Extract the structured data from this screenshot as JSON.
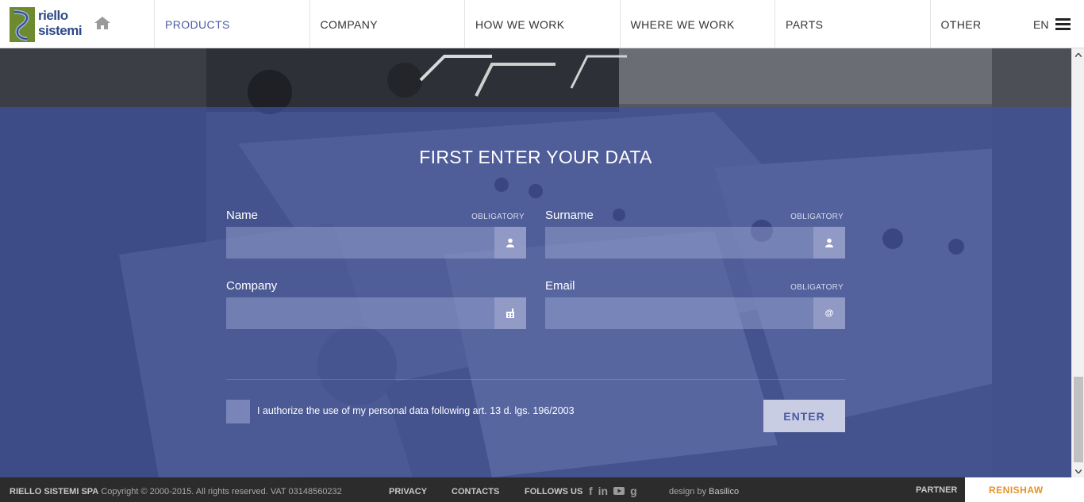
{
  "header": {
    "logo_text_line1": "riello",
    "logo_text_line2": "sistemi",
    "nav": [
      {
        "label": "PRODUCTS",
        "active": true
      },
      {
        "label": "COMPANY"
      },
      {
        "label": "HOW WE WORK"
      },
      {
        "label": "WHERE WE WORK"
      },
      {
        "label": "PARTS"
      },
      {
        "label": "OTHER"
      }
    ],
    "language": "EN"
  },
  "form": {
    "title": "FIRST ENTER YOUR DATA",
    "fields": {
      "name": {
        "label": "Name",
        "required": "OBLIGATORY",
        "value": "",
        "icon": "user-icon"
      },
      "surname": {
        "label": "Surname",
        "required": "OBLIGATORY",
        "value": "",
        "icon": "user-icon"
      },
      "company": {
        "label": "Company",
        "value": "",
        "icon": "building-icon"
      },
      "email": {
        "label": "Email",
        "required": "OBLIGATORY",
        "value": "",
        "icon": "at-icon",
        "icon_glyph": "@"
      }
    },
    "consent_text": "I authorize the use of my personal data following art. 13 d. lgs. 196/2003",
    "submit_label": "ENTER"
  },
  "footer": {
    "company": "RIELLO SISTEMI SPA",
    "copyright": "Copyright © 2000-2015. All rights reserved. VAT 03148560232",
    "privacy": "PRIVACY",
    "contacts": "CONTACTS",
    "follow_us": "FOLLOWS US",
    "social": [
      "facebook-icon",
      "linkedin-icon",
      "youtube-icon",
      "google-plus-icon"
    ],
    "design_by_label": "design by",
    "design_by_name": "Basilico",
    "partner_label": "PARTNER",
    "partner_name": "RENISHAW"
  },
  "colors": {
    "overlay": "#3e50a0",
    "accent": "#4a5aa0",
    "logo_green": "#6d8a2e",
    "footer_bg": "#2c2c2c",
    "partner_orange": "#e6932b"
  }
}
